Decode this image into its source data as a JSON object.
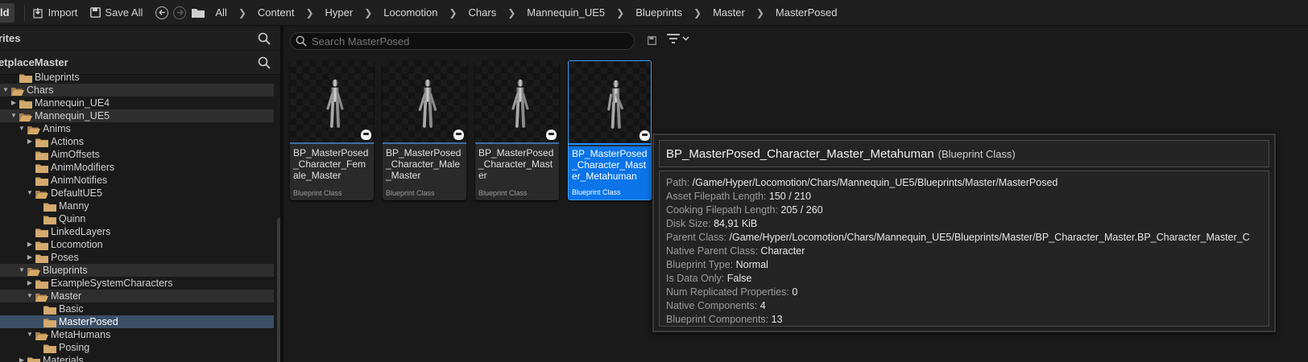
{
  "toolbar": {
    "add_label": "ld",
    "import_label": "Import",
    "save_all_label": "Save All",
    "breadcrumbs": [
      "All",
      "Content",
      "Hyper",
      "Locomotion",
      "Chars",
      "Mannequin_UE5",
      "Blueprints",
      "Master",
      "MasterPosed"
    ]
  },
  "sidebar": {
    "favorites_title": "rites",
    "collection_title": "etplaceMaster",
    "tree": [
      {
        "label": "Blueprints",
        "indent": 1,
        "arrow": "",
        "state": ""
      },
      {
        "label": "Chars",
        "indent": 0,
        "arrow": "open",
        "state": "hl"
      },
      {
        "label": "Mannequin_UE4",
        "indent": 1,
        "arrow": "closed",
        "state": ""
      },
      {
        "label": "Mannequin_UE5",
        "indent": 1,
        "arrow": "open",
        "state": "hl"
      },
      {
        "label": "Anims",
        "indent": 2,
        "arrow": "open",
        "state": ""
      },
      {
        "label": "Actions",
        "indent": 3,
        "arrow": "closed",
        "state": ""
      },
      {
        "label": "AimOffsets",
        "indent": 3,
        "arrow": "",
        "state": ""
      },
      {
        "label": "AnimModifiers",
        "indent": 3,
        "arrow": "",
        "state": ""
      },
      {
        "label": "AnimNotifies",
        "indent": 3,
        "arrow": "",
        "state": ""
      },
      {
        "label": "DefaultUE5",
        "indent": 3,
        "arrow": "open",
        "state": ""
      },
      {
        "label": "Manny",
        "indent": 4,
        "arrow": "",
        "state": ""
      },
      {
        "label": "Quinn",
        "indent": 4,
        "arrow": "",
        "state": ""
      },
      {
        "label": "LinkedLayers",
        "indent": 3,
        "arrow": "",
        "state": ""
      },
      {
        "label": "Locomotion",
        "indent": 3,
        "arrow": "closed",
        "state": ""
      },
      {
        "label": "Poses",
        "indent": 3,
        "arrow": "closed",
        "state": ""
      },
      {
        "label": "Blueprints",
        "indent": 2,
        "arrow": "open",
        "state": "hl"
      },
      {
        "label": "ExampleSystemCharacters",
        "indent": 3,
        "arrow": "closed",
        "state": ""
      },
      {
        "label": "Master",
        "indent": 3,
        "arrow": "open",
        "state": "hl"
      },
      {
        "label": "Basic",
        "indent": 4,
        "arrow": "",
        "state": ""
      },
      {
        "label": "MasterPosed",
        "indent": 4,
        "arrow": "",
        "state": "sel"
      },
      {
        "label": "MetaHumans",
        "indent": 3,
        "arrow": "open",
        "state": ""
      },
      {
        "label": "Posing",
        "indent": 4,
        "arrow": "",
        "state": ""
      },
      {
        "label": "Materials",
        "indent": 2,
        "arrow": "closed",
        "state": ""
      }
    ]
  },
  "search": {
    "placeholder": "Search MasterPosed",
    "value": ""
  },
  "assets": [
    {
      "name": "BP_MasterPosed_Character_Female_Master",
      "type": "Blueprint Class",
      "selected": false,
      "pose": "a"
    },
    {
      "name": "BP_MasterPosed_Character_Male_Master",
      "type": "Blueprint Class",
      "selected": false,
      "pose": "b"
    },
    {
      "name": "BP_MasterPosed_Character_Master",
      "type": "Blueprint Class",
      "selected": false,
      "pose": "a"
    },
    {
      "name": "BP_MasterPosed_Character_Master_Metahuman",
      "type": "Blueprint Class",
      "selected": true,
      "pose": "c"
    }
  ],
  "tooltip": {
    "name": "BP_MasterPosed_Character_Master_Metahuman",
    "class_label": "(Blueprint Class)",
    "properties": [
      {
        "key": "Path:",
        "value": "/Game/Hyper/Locomotion/Chars/Mannequin_UE5/Blueprints/Master/MasterPosed"
      },
      {
        "key": "Asset Filepath Length:",
        "value": "150 / 210"
      },
      {
        "key": "Cooking Filepath Length:",
        "value": "205 / 260"
      },
      {
        "key": "Disk Size:",
        "value": "84,91 KiB"
      },
      {
        "key": "Parent Class:",
        "value": "/Game/Hyper/Locomotion/Chars/Mannequin_UE5/Blueprints/Master/BP_Character_Master.BP_Character_Master_C"
      },
      {
        "key": "Native Parent Class:",
        "value": "Character"
      },
      {
        "key": "Blueprint Type:",
        "value": "Normal"
      },
      {
        "key": "Is Data Only:",
        "value": "False"
      },
      {
        "key": "Num Replicated Properties:",
        "value": "0"
      },
      {
        "key": "Native Components:",
        "value": "4"
      },
      {
        "key": "Blueprint Components:",
        "value": "13"
      }
    ]
  },
  "colors": {
    "selection": "#0a74e8",
    "folder": "#c9a066",
    "tree_selected": "#3a4e66"
  }
}
